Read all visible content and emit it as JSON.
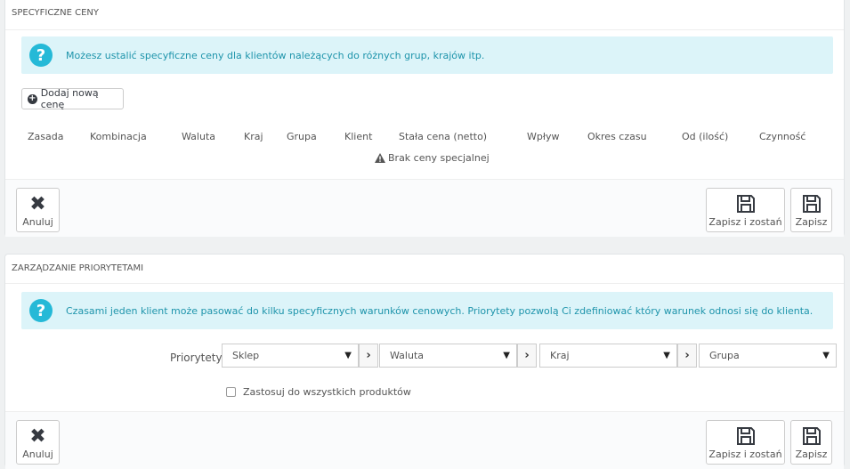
{
  "specific_prices": {
    "title": "Specyficzne ceny",
    "info": "Możesz ustalić specyficzne ceny dla klientów należących do różnych grup, krajów itp.",
    "add_button": "Dodaj nową cenę",
    "columns": [
      "Zasada",
      "Kombinacja",
      "Waluta",
      "Kraj",
      "Grupa",
      "Klient",
      "Stała cena (netto)",
      "Wpływ",
      "Okres czasu",
      "Od (ilość)",
      "Czynność"
    ],
    "empty": "Brak ceny specjalnej",
    "cancel": "Anuluj",
    "save_stay": "Zapisz i zostań",
    "save": "Zapisz"
  },
  "priorities": {
    "title": "Zarządzanie priorytetami",
    "info": "Czasami jeden klient może pasować do kilku specyficznych warunków cenowych. Priorytety pozwolą Ci zdefiniować który warunek odnosi się do klienta.",
    "label": "Priorytety",
    "selects": [
      "Sklep",
      "Waluta",
      "Kraj",
      "Grupa"
    ],
    "apply_all": "Zastosuj do wszystkich produktów"
  },
  "colors": {
    "info_bg": "#dcf4f9",
    "info_text": "#1e94ab",
    "info_icon": "#25b9d7"
  }
}
